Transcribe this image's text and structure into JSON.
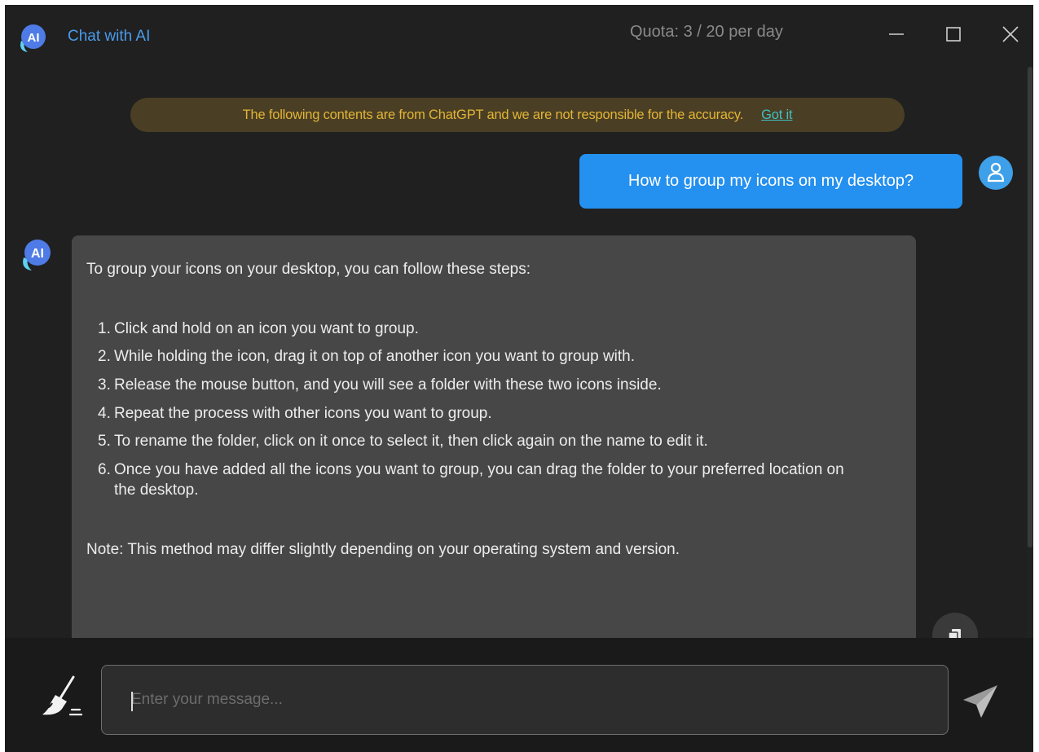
{
  "titlebar": {
    "app_title": "Chat with AI",
    "quota": "Quota: 3 / 20 per day"
  },
  "disclaimer": {
    "text": "The following contents are from ChatGPT and we are not responsible for the accuracy.",
    "link": "Got it"
  },
  "messages": {
    "user": "How to group my icons on my desktop?",
    "ai": {
      "intro": "To group your icons on your desktop, you can follow these steps:",
      "steps": [
        {
          "num": "1.",
          "text": "Click and hold on an icon you want to group."
        },
        {
          "num": "2.",
          "text": "While holding the icon, drag it on top of another icon you want to group with."
        },
        {
          "num": "3.",
          "text": "Release the mouse button, and you will see a folder with these two icons inside."
        },
        {
          "num": "4.",
          "text": "Repeat the process with other icons you want to group."
        },
        {
          "num": "5.",
          "text": "To rename the folder, click on it once to select it, then click again on the name to edit it."
        },
        {
          "num": "6.",
          "text": "Once you have added all the icons you want to group, you can drag the folder to your preferred location on the desktop."
        }
      ],
      "note": "Note: This method may differ slightly depending on your operating system and version."
    }
  },
  "avatars": {
    "ai_label": "AI"
  },
  "input": {
    "placeholder": "Enter your message...",
    "value": ""
  },
  "icons": {
    "app_logo": "ai-chat-logo",
    "minimize": "minimize-icon",
    "maximize": "maximize-icon",
    "close": "close-icon",
    "user_avatar": "user-icon",
    "copy": "copy-icon",
    "clear": "broom-icon",
    "send": "send-icon"
  },
  "colors": {
    "background": "#202020",
    "accent": "#2490ef",
    "title": "#4a9bea",
    "disclaimer_text": "#e2b437",
    "disclaimer_link": "#3fc0c6"
  }
}
